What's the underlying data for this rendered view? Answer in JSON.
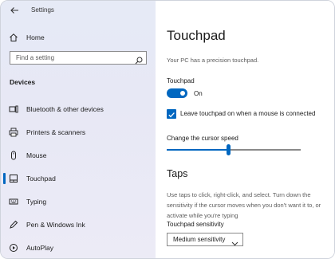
{
  "window": {
    "title": "Settings"
  },
  "sidebar": {
    "home_label": "Home",
    "search_placeholder": "Find a setting",
    "section": "Devices",
    "items": [
      {
        "label": "Bluetooth & other devices",
        "icon": "bluetooth-icon"
      },
      {
        "label": "Printers & scanners",
        "icon": "printer-icon"
      },
      {
        "label": "Mouse",
        "icon": "mouse-icon"
      },
      {
        "label": "Touchpad",
        "icon": "touchpad-icon",
        "selected": true
      },
      {
        "label": "Typing",
        "icon": "keyboard-icon"
      },
      {
        "label": "Pen & Windows Ink",
        "icon": "pen-icon"
      },
      {
        "label": "AutoPlay",
        "icon": "autoplay-icon"
      }
    ]
  },
  "main": {
    "title": "Touchpad",
    "subtitle": "Your PC has a precision touchpad.",
    "touchpad_toggle": {
      "label": "Touchpad",
      "state_text": "On",
      "on": true
    },
    "leave_on_checkbox": {
      "label": "Leave touchpad on when a mouse is connected",
      "checked": true
    },
    "cursor_speed": {
      "label": "Change the cursor speed",
      "value_fraction": 0.46
    },
    "taps": {
      "heading": "Taps",
      "description": "Use taps to click, right-click, and select. Turn down the sensitivity if the cursor moves when you don't want it to, or activate while you're typing",
      "sensitivity_label": "Touchpad sensitivity",
      "sensitivity_value": "Medium sensitivity"
    }
  },
  "colors": {
    "accent": "#0067c0",
    "sidebar_bg": "#e7e9f5"
  }
}
